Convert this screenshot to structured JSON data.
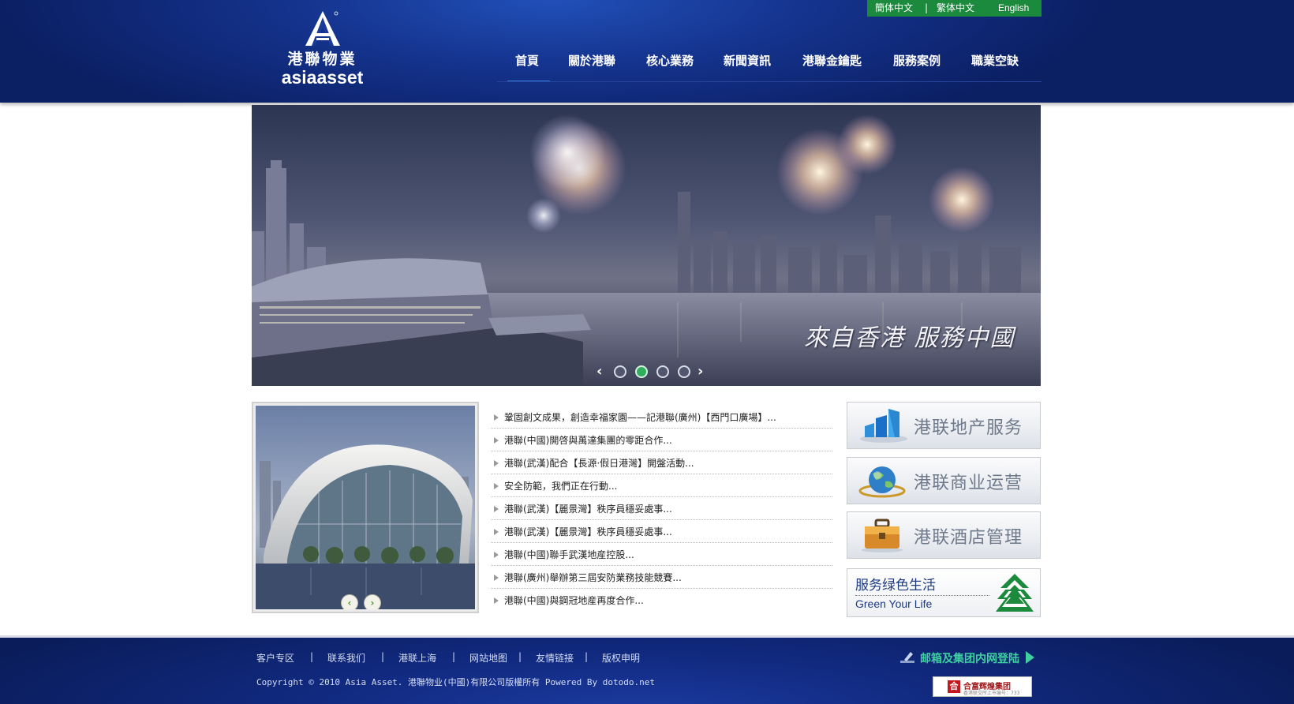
{
  "header": {
    "logo": {
      "cn": "港聯物業",
      "en": "asiaasset"
    },
    "languages": [
      "簡体中文",
      "|",
      "繁体中文",
      "English"
    ],
    "nav": [
      "首頁",
      "關於港聯",
      "核心業務",
      "新聞資訊",
      "港聯金鑰匙",
      "服務案例",
      "職業空缺"
    ],
    "active_nav": "首頁"
  },
  "banner": {
    "slogan": "來自香港  服務中國",
    "slides": 4,
    "active_slide": 2,
    "prev": "‹",
    "next": "›"
  },
  "photo": {
    "prev": "‹",
    "next": "›"
  },
  "news": [
    "鞏固創文成果，創造幸福家園——記港聯(廣州)【西門口廣場】...",
    "港聯(中國)開啓與萬達集團的零距合作...",
    "港聯(武漢)配合【長源·假日港灣】開盤活動...",
    "安全防範，我們正在行動...",
    "港聯(武漢)【麗景灣】秩序員穩妥處事...",
    "港聯(武漢)【麗景灣】秩序員穩妥處事...",
    "港聯(中國)聯手武漢地産控股...",
    "港聯(廣州)舉辦第三屆安防業務技能競賽...",
    "港聯(中國)與鋼冠地産再度合作..."
  ],
  "services": [
    {
      "label": "港联地产服务",
      "icon": "buildings-icon"
    },
    {
      "label": "港联商业运营",
      "icon": "globe-icon"
    },
    {
      "label": "港联酒店管理",
      "icon": "briefcase-icon"
    }
  ],
  "green": {
    "title": "服务绿色生活",
    "subtitle": "Green Your Life"
  },
  "footer": {
    "links": [
      "客户专区",
      "|",
      "联系我们",
      "|",
      "港联上海",
      "|",
      "网站地图",
      "|",
      "友情链接",
      "|",
      "版权申明"
    ],
    "copyright": "Copyright © 2010 Asia Asset. 港聯物业(中國)有限公司版權所有 Powered By dotodo.net",
    "mail_login": "邮箱及集团内网登陆",
    "badge_title": "合富辉煌集团",
    "badge_sub": "香港联交所上市编号：733"
  },
  "colors": {
    "header_blue": "#0b1f63",
    "lang_green": "#1c8a3c",
    "accent_green": "#3fd0a0",
    "service_text": "#6e7a8c"
  }
}
